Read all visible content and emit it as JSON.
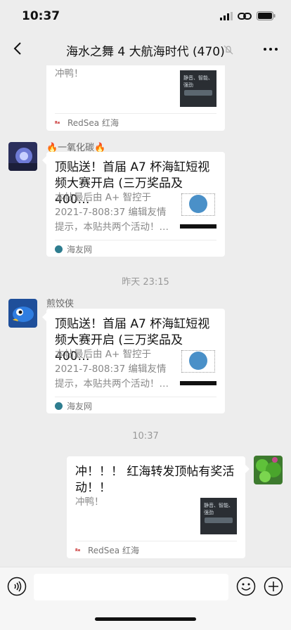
{
  "status": {
    "time": "10:37"
  },
  "nav": {
    "title": "海水之舞 4 大航海时代 (470)"
  },
  "messages": {
    "first": {
      "desc": "冲鸭！",
      "thumb_text": "静音、智能、强劲",
      "source": "RedSea 红海"
    },
    "second": {
      "sender": "🔥一氧化碳🔥",
      "title": "顶贴送！首届 A7 杯海缸短视频大赛开启 (三万奖品及 400…",
      "desc": "本帖最后由 A+ 智控于 2021-7-808:37 编辑友情提示，本贴共两个活动！…",
      "source": "海友网"
    },
    "time_sep_1": "昨天 23:15",
    "third": {
      "sender": "煎饺侠",
      "title": "顶贴送！首届 A7 杯海缸短视频大赛开启 (三万奖品及 400…",
      "desc": "本帖最后由 A+ 智控于 2021-7-808:37 编辑友情提示，本贴共两个活动！…",
      "source": "海友网"
    },
    "time_sep_2": "10:37",
    "fourth": {
      "title": "冲！！！ 红海转发顶帖有奖活动！！",
      "desc": "冲鸭！",
      "thumb_text": "静音、智能、强劲",
      "source": "RedSea 红海"
    }
  },
  "colors": {
    "background": "#ededed",
    "bubble": "#ffffff",
    "accent_wechat": "#07c160"
  }
}
